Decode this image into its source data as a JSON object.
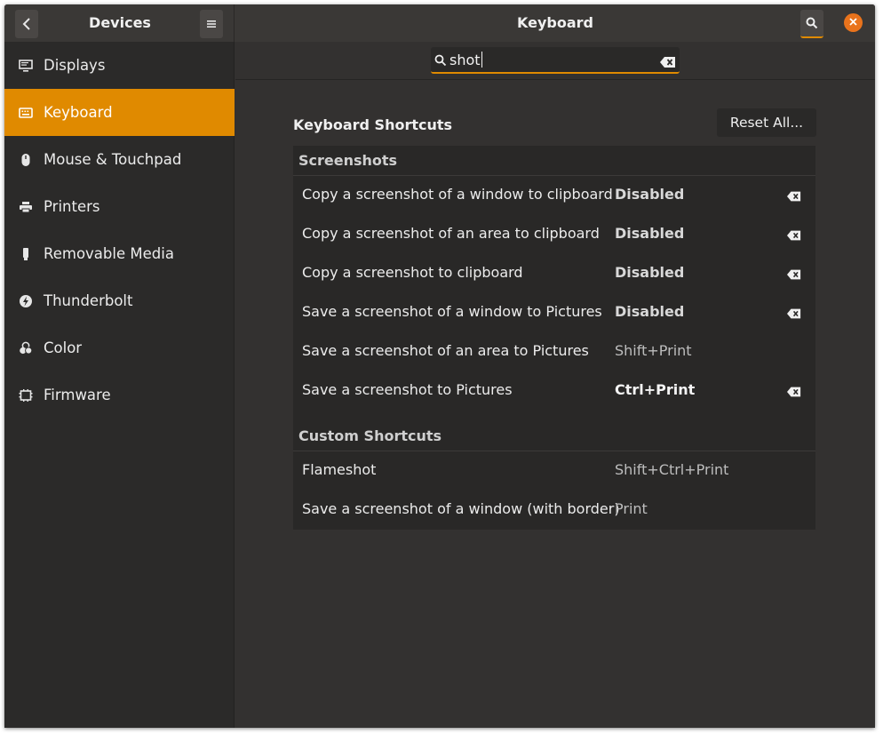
{
  "header": {
    "sidebar_title": "Devices",
    "main_title": "Keyboard",
    "back_icon": "chevron-left-icon",
    "menu_icon": "hamburger-menu-icon",
    "search_icon": "search-icon",
    "close_icon": "close-icon"
  },
  "sidebar": {
    "items": [
      {
        "label": "Displays",
        "icon": "display-icon",
        "active": false
      },
      {
        "label": "Keyboard",
        "icon": "keyboard-icon",
        "active": true
      },
      {
        "label": "Mouse & Touchpad",
        "icon": "mouse-icon",
        "active": false
      },
      {
        "label": "Printers",
        "icon": "printer-icon",
        "active": false
      },
      {
        "label": "Removable Media",
        "icon": "usb-drive-icon",
        "active": false
      },
      {
        "label": "Thunderbolt",
        "icon": "thunderbolt-icon",
        "active": false
      },
      {
        "label": "Color",
        "icon": "color-icon",
        "active": false
      },
      {
        "label": "Firmware",
        "icon": "chip-icon",
        "active": false
      }
    ]
  },
  "search": {
    "value": "shot",
    "clear_icon": "backspace-clear-icon"
  },
  "main": {
    "section_title": "Keyboard Shortcuts",
    "reset_label": "Reset All...",
    "groups": [
      {
        "title": "Screenshots",
        "rows": [
          {
            "name": "Copy a screenshot of a window to clipboard",
            "accel": "Disabled",
            "clearable": true
          },
          {
            "name": "Copy a screenshot of an area to clipboard",
            "accel": "Disabled",
            "clearable": true
          },
          {
            "name": "Copy a screenshot to clipboard",
            "accel": "Disabled",
            "clearable": true
          },
          {
            "name": "Save a screenshot of a window to Pictures",
            "accel": "Disabled",
            "clearable": true
          },
          {
            "name": "Save a screenshot of an area to Pictures",
            "accel": "Shift+Print",
            "clearable": false
          },
          {
            "name": "Save a screenshot to Pictures",
            "accel": "Ctrl+Print",
            "clearable": true
          }
        ]
      },
      {
        "title": "Custom Shortcuts",
        "rows": [
          {
            "name": "Flameshot",
            "accel": "Shift+Ctrl+Print",
            "clearable": false
          },
          {
            "name": "Save a screenshot of a window (with border)",
            "accel": "Print",
            "clearable": false
          }
        ]
      }
    ]
  },
  "colors": {
    "accent": "#e08a00",
    "close": "#e9731c",
    "background": "#333130",
    "sidebar": "#2b2a29"
  }
}
